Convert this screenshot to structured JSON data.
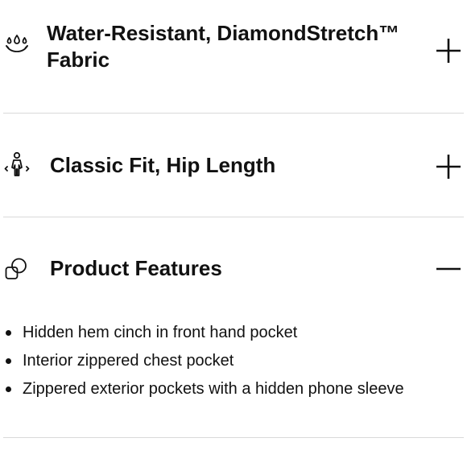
{
  "accordion": {
    "items": [
      {
        "icon": "water-drops-icon",
        "title_line1": "Water-Resistant, DiamondStretch™",
        "title_line2": "Fabric",
        "state": "collapsed"
      },
      {
        "icon": "person-fit-icon",
        "title": "Classic Fit, Hip Length",
        "state": "collapsed"
      },
      {
        "icon": "overlapping-shapes-icon",
        "title": "Product Features",
        "state": "expanded",
        "features": [
          "Hidden hem cinch in front hand pocket",
          "Interior zippered chest pocket",
          "Zippered exterior pockets with a hidden phone sleeve"
        ]
      }
    ]
  },
  "colors": {
    "text": "#111111",
    "divider": "#d9d9d9",
    "background": "#ffffff"
  }
}
